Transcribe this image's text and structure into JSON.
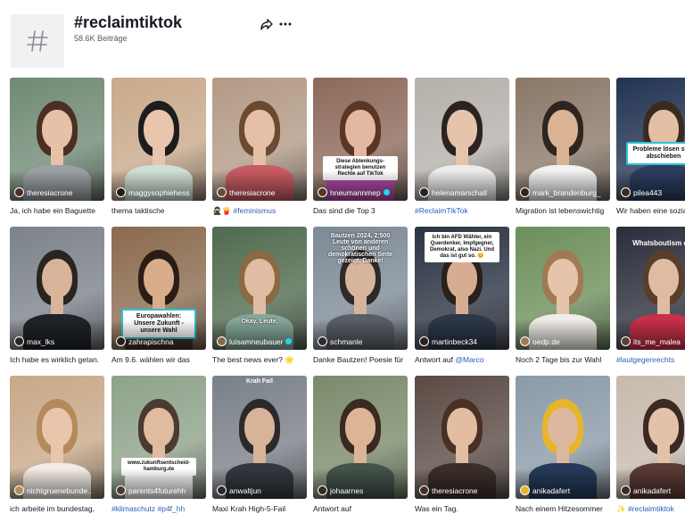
{
  "header": {
    "title": "#reclaimtiktok",
    "posts": "58.6K Beiträge",
    "icons": {
      "tag": "hashtag-icon",
      "share": "share-icon",
      "more": "more-icon"
    }
  },
  "videos": [
    {
      "author": "theresiacrone",
      "verified": false,
      "caption": "Ja, ich habe ein Baguette",
      "caption_link": "",
      "caption_rest": "",
      "bg": "#6f8a74",
      "skin": "#e6c1a8",
      "hair": "#4a2f22",
      "shirt": "#9aa0a4",
      "overlay": ""
    },
    {
      "author": "maggysophiehess",
      "verified": false,
      "caption": "thema taktische ",
      "caption_link": "",
      "caption_rest": "",
      "bg": "#c9a98a",
      "skin": "#e8c5ac",
      "hair": "#1d1d1d",
      "shirt": "#cfe0d4",
      "overlay": ""
    },
    {
      "author": "theresiacrone",
      "verified": false,
      "caption": "",
      "caption_link": "🥷🏻🍟 #feminismus",
      "caption_rest": "",
      "bg": "#b39a86",
      "skin": "#e5c0a6",
      "hair": "#6b4a32",
      "shirt": "#c95b62",
      "overlay": ""
    },
    {
      "author": "hneumannmep",
      "verified": true,
      "caption": "Das sind die Top 3",
      "caption_link": "",
      "caption_rest": "",
      "bg": "#8d6a5a",
      "skin": "#e2b9a0",
      "hair": "#5a3624",
      "shirt": "#b04aa8",
      "overlay": "Diese Ablenkungs- strategien benutzen Rechte auf TikTok"
    },
    {
      "author": "helenamarschall",
      "verified": false,
      "caption": "",
      "caption_link": "#ReclaimTikTok",
      "caption_rest": "",
      "bg": "#b5b0aa",
      "skin": "#e6c3ab",
      "hair": "#2b2320",
      "shirt": "#ececec",
      "overlay": ""
    },
    {
      "author": "mark_brandenburg_",
      "verified": false,
      "caption": "Migration ist lebenswichtig",
      "caption_link": "",
      "caption_rest": "",
      "bg": "#8a7868",
      "skin": "#d9b394",
      "hair": "#2e2420",
      "shirt": "#f2f2f2",
      "overlay": ""
    },
    {
      "author": "pilea443",
      "verified": false,
      "caption": "Wir haben eine sozia",
      "caption_link": "",
      "caption_rest": "",
      "bg": "#223352",
      "skin": "#e3bfa6",
      "hair": "#3a2a20",
      "shirt": "#2c3c5e",
      "overlay": "Probleme lösen statt abschieben"
    },
    {
      "author": "max_lks",
      "verified": false,
      "caption": "Ich habe es wirklich getan.",
      "caption_link": "",
      "caption_rest": "",
      "bg": "#7c828a",
      "skin": "#d8b49a",
      "hair": "#2a2420",
      "shirt": "#1f2328",
      "overlay": ""
    },
    {
      "author": "zahrapischna",
      "verified": false,
      "caption": "Am 9.6. wählen wir das",
      "caption_link": "",
      "caption_rest": "",
      "bg": "#8a6a4e",
      "skin": "#d9ad8c",
      "hair": "#2b1d16",
      "shirt": "#3d2f2a",
      "overlay": "Europawahlen: Unsere Zukunft - unsere Wahl"
    },
    {
      "author": "luisamneubauer",
      "verified": true,
      "caption": "The best news ever? 🌟",
      "caption_link": "",
      "caption_rest": "",
      "bg": "#4f6a4e",
      "skin": "#e0bca2",
      "hair": "#8a6a44",
      "shirt": "#86a89a",
      "overlay": "Okay, Leute,"
    },
    {
      "author": "schmanle",
      "verified": false,
      "caption": "Danke Bautzen! Poesie für",
      "caption_link": "",
      "caption_rest": "",
      "bg": "#7c8a96",
      "skin": "#d7b59c",
      "hair": "#2e2a2a",
      "shirt": "#5a5f66",
      "overlay": "Bautzen 2024, 2:500 Leute von anderen schönen und demokratischen Seite gezeigt. Danke!"
    },
    {
      "author": "martinbeck34",
      "verified": false,
      "caption": "Antwort auf ",
      "caption_link": "@Marco",
      "caption_rest": "",
      "bg": "#2a3342",
      "skin": "#d7ad92",
      "hair": "#2a211c",
      "shirt": "#2d3848",
      "overlay": "Ich bin AFD Wähler, ein Querdenker, Impfgegner, Demokrat, also Nazi. Und das ist gut so. 😊"
    },
    {
      "author": "oedp.de",
      "verified": false,
      "caption": "Noch 2 Tage bis zur Wahl",
      "caption_link": "",
      "caption_rest": "",
      "bg": "#6c8f5a",
      "skin": "#e6c4aa",
      "hair": "#a07a52",
      "shirt": "#f0ede8",
      "overlay": ""
    },
    {
      "author": "its_me_malea",
      "verified": false,
      "caption": "",
      "caption_link": "#lautgegenrechts",
      "caption_rest": "",
      "bg": "#2a2d3a",
      "skin": "#dfbba2",
      "hair": "#5a3e2c",
      "shirt": "#c8304a",
      "overlay": "Whatsboutism der"
    },
    {
      "author": "nichtgruenebunde..",
      "verified": false,
      "caption": "ich arbeite im bundestag,",
      "caption_link": "",
      "caption_rest": "",
      "bg": "#c8a888",
      "skin": "#e9c6ab",
      "hair": "#b58a5a",
      "shirt": "#f2ece4",
      "overlay": ""
    },
    {
      "author": "parents4futurehh",
      "verified": false,
      "caption": "",
      "caption_link": "#klimaschutz #p4f_hh",
      "caption_rest": "",
      "bg": "#8ea28a",
      "skin": "#e0bba0",
      "hair": "#4a3a30",
      "shirt": "#f4f4f4",
      "overlay": "www.zukunftsentscheid-hamburg.de"
    },
    {
      "author": "anwaltjun",
      "verified": false,
      "caption": "Maxi Krah High-5-Fail",
      "caption_link": "",
      "caption_rest": "",
      "bg": "#7a8088",
      "skin": "#d8b398",
      "hair": "#2a2a2a",
      "shirt": "#34383e",
      "overlay": "Krah Fail"
    },
    {
      "author": "johaarnes",
      "verified": false,
      "caption": "Antwort auf",
      "caption_link": "",
      "caption_rest": "",
      "bg": "#7a8a6a",
      "skin": "#dcb596",
      "hair": "#3a2a20",
      "shirt": "#44524a",
      "overlay": ""
    },
    {
      "author": "theresiacrone",
      "verified": false,
      "caption": "Was ein Tag.",
      "caption_link": "",
      "caption_rest": "",
      "bg": "#5a4a44",
      "skin": "#e2bda2",
      "hair": "#4a3024",
      "shirt": "#3a2e2a",
      "overlay": ""
    },
    {
      "author": "anikadafert",
      "verified": false,
      "caption": "Nach einem Hitzesommer",
      "caption_link": "",
      "caption_rest": "",
      "bg": "#8a9aa8",
      "skin": "#dcb99e",
      "hair": "#e8b42a",
      "shirt": "#253a5a",
      "overlay": ""
    },
    {
      "author": "anikadafert",
      "verified": false,
      "caption": "✨ ",
      "caption_link": "#reclaimtiktok",
      "caption_rest": "",
      "bg": "#c7b9ad",
      "skin": "#e3c2aa",
      "hair": "#3a2a22",
      "shirt": "#5a3a34",
      "overlay": ""
    }
  ]
}
